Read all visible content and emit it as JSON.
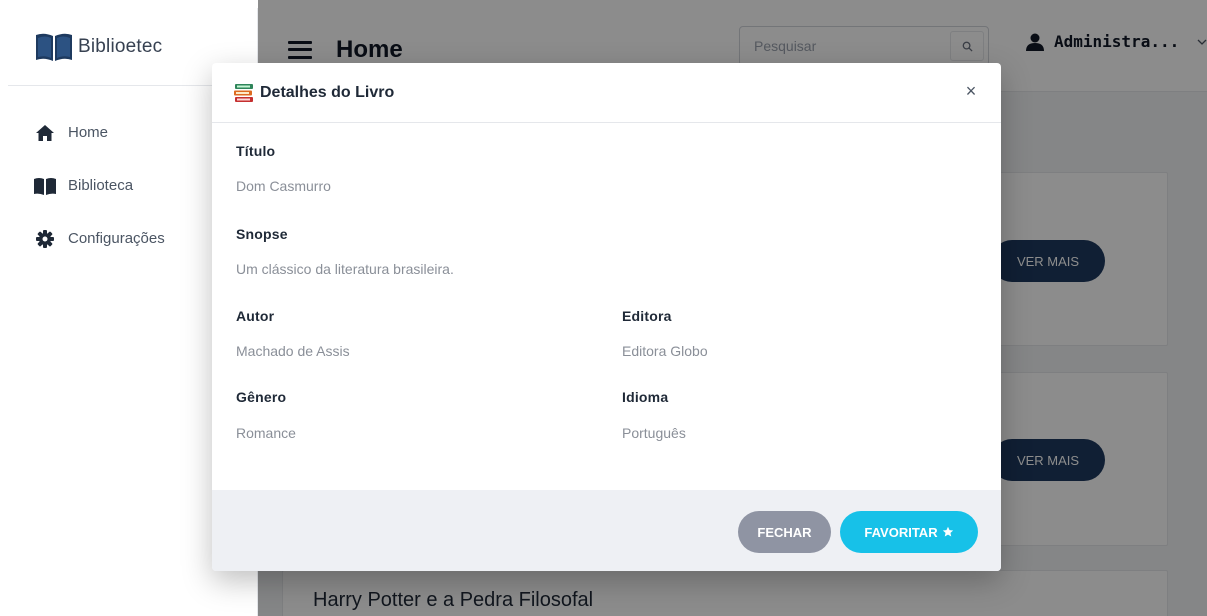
{
  "app": {
    "name": "Biblioetec"
  },
  "sidebar": {
    "items": [
      {
        "label": "Home",
        "icon": "home-icon"
      },
      {
        "label": "Biblioteca",
        "icon": "book-open-icon"
      },
      {
        "label": "Configurações",
        "icon": "gear-icon"
      }
    ]
  },
  "header": {
    "title": "Home",
    "search_placeholder": "Pesquisar",
    "user_name": "Administra..."
  },
  "cards": [
    {
      "button_label": "VER MAIS"
    },
    {
      "button_label": "VER MAIS"
    },
    {
      "title": "Harry Potter e a Pedra Filosofal"
    }
  ],
  "modal": {
    "title": "Detalhes do Livro",
    "close_label": "×",
    "fields": {
      "titulo_label": "Título",
      "titulo_value": "Dom Casmurro",
      "sinopse_label": "Snopse",
      "sinopse_value": "Um clássico da literatura brasileira.",
      "autor_label": "Autor",
      "autor_value": "Machado de Assis",
      "editora_label": "Editora",
      "editora_value": "Editora Globo",
      "genero_label": "Gênero",
      "genero_value": "Romance",
      "idioma_label": "Idioma",
      "idioma_value": "Português"
    },
    "buttons": {
      "fechar": "FECHAR",
      "favoritar": "FAVORITAR"
    }
  },
  "colors": {
    "accent": "#17c1e8",
    "primary_dark": "#1e3a5f",
    "secondary": "#8f94a3"
  }
}
